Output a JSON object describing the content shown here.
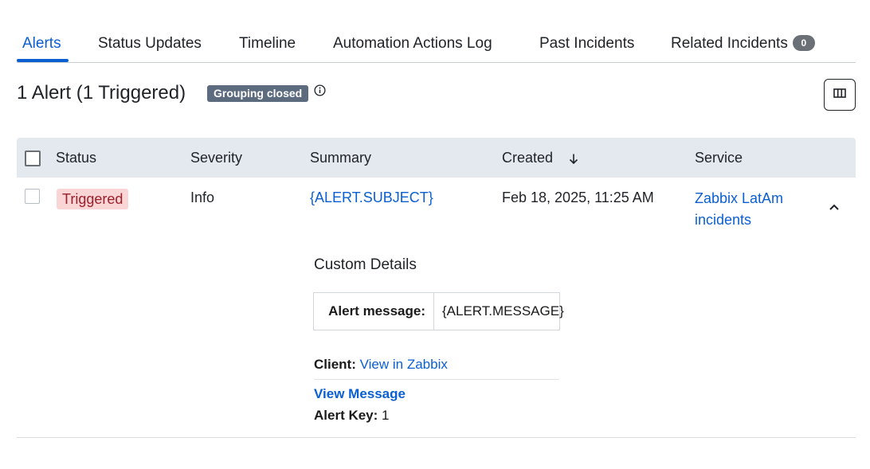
{
  "tabs": {
    "alerts": "Alerts",
    "status_updates": "Status Updates",
    "timeline": "Timeline",
    "automation_log": "Automation Actions Log",
    "past_incidents": "Past Incidents",
    "related_incidents": "Related Incidents",
    "related_count": "0",
    "active": "Alerts"
  },
  "header": {
    "title": "1 Alert (1 Triggered)",
    "grouping_badge": "Grouping closed",
    "info_icon": "info-circle-icon",
    "columns_icon": "columns-icon"
  },
  "table": {
    "columns": {
      "status": "Status",
      "severity": "Severity",
      "summary": "Summary",
      "created": "Created",
      "service": "Service"
    },
    "sort_icon": "arrow-down-icon",
    "rows": [
      {
        "status": "Triggered",
        "severity": "Info",
        "summary": "{ALERT.SUBJECT}",
        "created": "Feb 18, 2025, 11:25 AM",
        "service": "Zabbix LatAm incidents",
        "expand_icon": "chevron-up-icon"
      }
    ]
  },
  "details": {
    "title": "Custom Details",
    "message_key": "Alert message:",
    "message_value": "{ALERT.MESSAGE}",
    "client_label": "Client:",
    "client_link": "View in Zabbix",
    "view_message": "View Message",
    "alert_key_label": "Alert Key:",
    "alert_key_value": "1"
  },
  "colors": {
    "accent": "#0b5fd1",
    "header_bg": "#e4e9f0",
    "triggered_bg": "#f9d5d6",
    "triggered_text": "#9a1f2a",
    "grouping_badge_bg": "#5c6b7e"
  }
}
